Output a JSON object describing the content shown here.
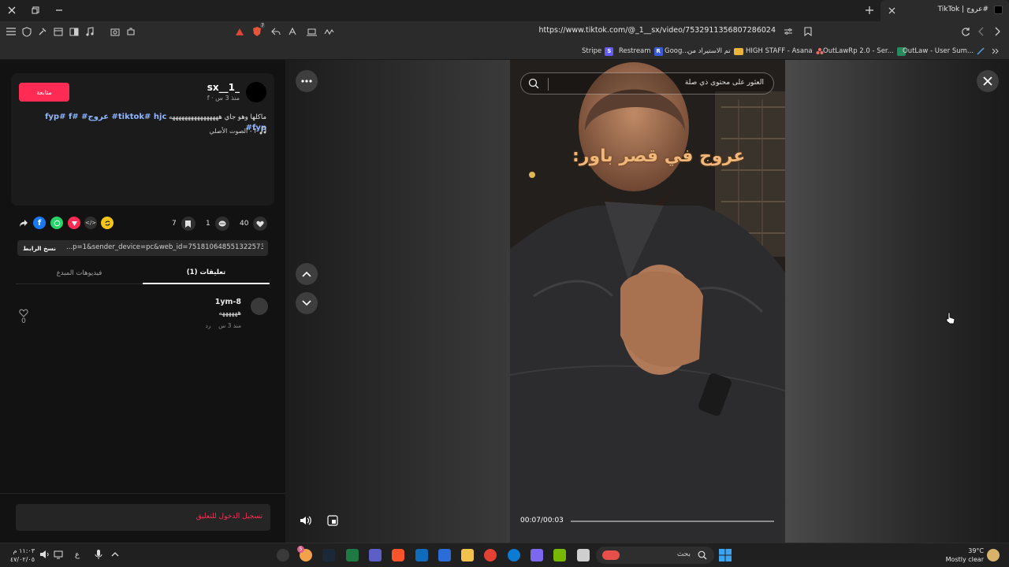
{
  "browser": {
    "tab_title": "TikTok | عروج#",
    "url": "https://www.tiktok.com/@_1__sx/video/7532911356807286024",
    "shields_count": "7",
    "bookmarks": [
      {
        "label": "Stripe",
        "badge": "S",
        "color": "#635bff"
      },
      {
        "label": "Restream",
        "badge": "R",
        "color": "#3b5bdb"
      },
      {
        "label": "Goog...",
        "badge": "",
        "color": ""
      },
      {
        "label": "تم الاستيراد من",
        "badge": "",
        "color": "#e8b53a"
      },
      {
        "label": "HIGH STAFF - Asana",
        "badge": "",
        "color": "#f06a6a"
      },
      {
        "label": "OutLawRp 2.0 - Ser...",
        "badge": "",
        "color": "#3dbb7a"
      },
      {
        "label": "OutLaw - User Sum...",
        "badge": "",
        "color": ""
      }
    ]
  },
  "post": {
    "username": "sx__1_",
    "subtitle": "f · منذ 3 س",
    "follow_label": "متابعة",
    "description_text": "ماكلها وهو جاي ههههههههههههههههه",
    "description_tags": "tiktok# hjc# عروج# fyp# f# fyp#",
    "sound": "الصوت الأصلي - f",
    "likes": "40",
    "comments": "1",
    "saves": "7",
    "link_text": "...p=1&sender_device=pc&web_id=7518106485513225735",
    "copy_link_label": "نسخ الرابط",
    "tab_comments": "تعليقات (1)",
    "tab_creator_videos": "فيديوهات المبدع"
  },
  "comments": [
    {
      "user": "1ym-8",
      "text": "ههههههه",
      "time": "منذ 3 س",
      "reply": "رد",
      "likes": "0"
    }
  ],
  "login_prompt": "تسجيل الدخول للتعليق",
  "player": {
    "search_placeholder": "العثور على محتوى ذي صلة",
    "overlay_caption": "عروج في قصر باور:",
    "time": "00:07/00:03",
    "progress": 0.0
  },
  "taskbar": {
    "search_placeholder": "بحث",
    "weather_temp": "39°C",
    "weather_desc": "Mostly clear",
    "clock_time": "١١:٠٣ م",
    "clock_date": "٤٧/٠٢/٠٥",
    "lang": "ع",
    "notif_count": "5"
  }
}
